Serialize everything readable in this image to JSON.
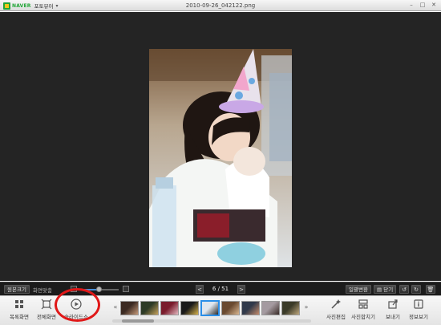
{
  "app": {
    "brand": "NAVER",
    "name": "포토뷰어",
    "window_title": "2010-09-26_042122.png"
  },
  "window_controls": {
    "minimize": "–",
    "maximize": "□",
    "close": "✕"
  },
  "viewer": {
    "background": "#242424"
  },
  "controls": {
    "original_size_label": "원본크기",
    "fit_screen_label": "화면맞춤",
    "zoom": {
      "level": 0.5
    },
    "pager": {
      "prev": "<",
      "count": "6 / 51",
      "next": ">"
    },
    "batch_convert_label": "일괄변환",
    "print_label": "닫기"
  },
  "toolbar": {
    "list_view_label": "목록화면",
    "fullscreen_label": "전체화면",
    "slideshow_label": "슬라이드쇼",
    "edit_photo_label": "사진편집",
    "merge_photo_label": "사진합치기",
    "send_label": "보내기",
    "info_label": "정보보기",
    "prev_arrow": "«",
    "next_arrow": "»"
  },
  "filmstrip": {
    "selected_index": 4,
    "thumbnails": [
      {
        "colors": [
          "#3b2a22",
          "#c79a79"
        ]
      },
      {
        "colors": [
          "#2d3a26",
          "#c7a15a"
        ]
      },
      {
        "colors": [
          "#7a1c2c",
          "#e3b8c0"
        ]
      },
      {
        "colors": [
          "#1a1a1a",
          "#d8b34a"
        ]
      },
      {
        "colors": [
          "#dfe6ee",
          "#2a2a2a"
        ]
      },
      {
        "colors": [
          "#6a4a30",
          "#d9b690"
        ]
      },
      {
        "colors": [
          "#30394a",
          "#c58a6a"
        ]
      },
      {
        "colors": [
          "#a49aa0",
          "#3a2c28"
        ]
      },
      {
        "colors": [
          "#3a3a28",
          "#bda67c"
        ]
      }
    ]
  },
  "annotation_color": "#e01818"
}
